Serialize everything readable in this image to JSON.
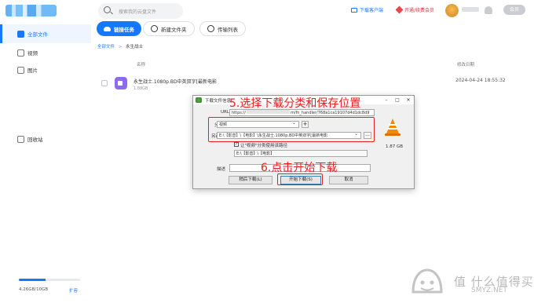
{
  "search": {
    "placeholder": "搜索我的云盘文件"
  },
  "header": {
    "download_client": "下载客户端",
    "vip": "开通/续费会员",
    "user_badge": "会员"
  },
  "sidebar": {
    "items": [
      {
        "label": "全部文件",
        "active": true
      },
      {
        "label": "视频"
      },
      {
        "label": "图片"
      },
      {
        "label": "回收站"
      }
    ],
    "storage": {
      "text": "4.26GB/10GB",
      "expand": "扩容",
      "used_fraction": 0.43
    }
  },
  "toolbar": {
    "new_task": "链接任务",
    "new_folder": "新建文件夹",
    "transfer_list": "传输列表"
  },
  "breadcrumb": {
    "root": "全部文件",
    "sep": ">",
    "current": "永生战士"
  },
  "table": {
    "col_name": "名称",
    "col_date": "修改日期",
    "rows": [
      {
        "name": "永生战士.1080p.BD中英双字[最新电影",
        "size": "1.88GB",
        "date": "2024-04-24 18:55:32"
      }
    ]
  },
  "dialog": {
    "title": "下载文件信息",
    "min": "–",
    "max": "□",
    "close": "✕",
    "url_label": "URL",
    "url_value": "https://",
    "url_value_tail": "m/fn_handler/768a1ca19107d4d1dc8d9",
    "category_label": "分类",
    "category_value": "视频",
    "add_category": "+",
    "saveas_label": "另存为",
    "saveas_value": "E:\\【影音】\\【电影】\\永生战士.1080p.BD中英双字[最新电影",
    "browse": "...",
    "remember_label": "让\"视频\"分类使用该路径",
    "remember_checked": true,
    "path_value": "E:\\【影音】\\【电影】",
    "desc_label": "描述",
    "file_size": "1.87 GB",
    "later_button": "稍后下载(L)",
    "start_button": "开始下载(S)",
    "cancel_button": "取消"
  },
  "annotations": {
    "step5": "5.选择下载分类和保存位置",
    "step6": "6.点击开始下载",
    "color": "#e62020"
  },
  "watermark": {
    "text": "值 什么值得买",
    "sub": "SMYZ.NET"
  },
  "colors": {
    "accent": "#1677ff",
    "video_icon": "#8b6cf0"
  }
}
